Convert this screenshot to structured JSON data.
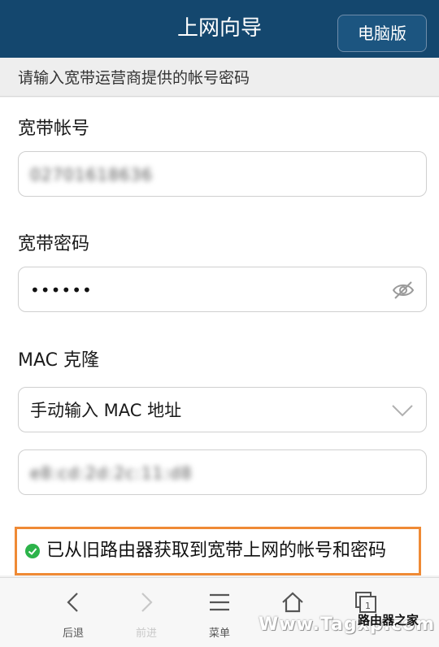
{
  "header": {
    "title": "上网向导",
    "pc_version_label": "电脑版"
  },
  "subtitle": "请输入宽带运营商提供的帐号密码",
  "form": {
    "account": {
      "label": "宽带帐号",
      "value": "02701618636"
    },
    "password": {
      "label": "宽带密码",
      "value": "••••••",
      "toggle_icon": "eye-icon"
    },
    "mac_clone": {
      "label": "MAC 克隆",
      "selected_option": "手动输入 MAC 地址",
      "mac_value": "e8:cd:2d:2c:11:d8"
    }
  },
  "status": {
    "message": "已从旧路由器获取到宽带上网的帐号和密码",
    "color": "#ef8a35",
    "icon": "check-circle-icon"
  },
  "bottom_nav": {
    "items": [
      {
        "label": "后退",
        "icon": "chevron-left-icon"
      },
      {
        "label": "前进",
        "icon": "chevron-right-icon"
      },
      {
        "label": "菜单",
        "icon": "menu-icon"
      },
      {
        "label": "",
        "icon": "home-icon"
      },
      {
        "label": "",
        "icon": "windows-icon",
        "badge": "1"
      }
    ]
  },
  "watermark": {
    "url": "Www.Tagxp.com",
    "text": "路由器之家"
  },
  "colors": {
    "header_bg": "#14476e",
    "accent_orange": "#ef8a35",
    "success_green": "#2cb34a"
  }
}
